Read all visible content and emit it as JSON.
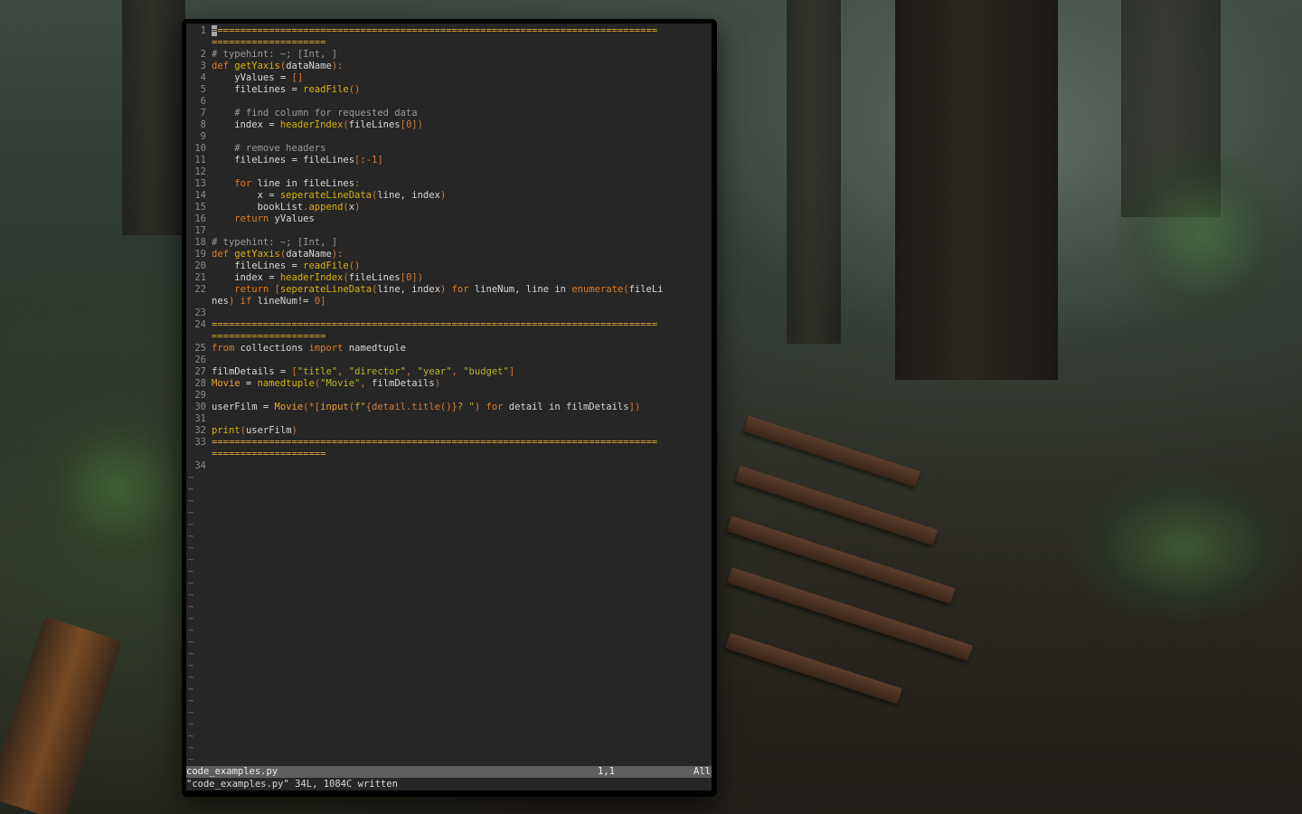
{
  "editor": {
    "lines": [
      {
        "n": "1",
        "segs": [
          {
            "t": "=",
            "c": "cursor"
          },
          {
            "t": "=============================================================================",
            "c": "t-eq"
          }
        ]
      },
      {
        "n": "",
        "segs": [
          {
            "t": "====================",
            "c": "t-eq"
          }
        ]
      },
      {
        "n": "2",
        "segs": [
          {
            "t": "# typehint: ~; [Int, ]",
            "c": "t-c"
          }
        ]
      },
      {
        "n": "3",
        "segs": [
          {
            "t": "def ",
            "c": "t-k"
          },
          {
            "t": "getYaxis",
            "c": "t-f"
          },
          {
            "t": "(",
            "c": "t-p"
          },
          {
            "t": "dataName",
            "c": "t-n"
          },
          {
            "t": "):",
            "c": "t-p"
          }
        ]
      },
      {
        "n": "4",
        "segs": [
          {
            "t": "    yValues = ",
            "c": "t-n"
          },
          {
            "t": "[]",
            "c": "t-p"
          }
        ]
      },
      {
        "n": "5",
        "segs": [
          {
            "t": "    fileLines = ",
            "c": "t-n"
          },
          {
            "t": "readFile",
            "c": "t-f"
          },
          {
            "t": "()",
            "c": "t-p"
          }
        ]
      },
      {
        "n": "6",
        "segs": []
      },
      {
        "n": "7",
        "segs": [
          {
            "t": "    # find column for requested data",
            "c": "t-c"
          }
        ]
      },
      {
        "n": "8",
        "segs": [
          {
            "t": "    index = ",
            "c": "t-n"
          },
          {
            "t": "headerIndex",
            "c": "t-f"
          },
          {
            "t": "(",
            "c": "t-p"
          },
          {
            "t": "fileLines",
            "c": "t-n"
          },
          {
            "t": "[0])",
            "c": "t-p"
          }
        ]
      },
      {
        "n": "9",
        "segs": []
      },
      {
        "n": "10",
        "segs": [
          {
            "t": "    # remove headers",
            "c": "t-c"
          }
        ]
      },
      {
        "n": "11",
        "segs": [
          {
            "t": "    fileLines = fileLines",
            "c": "t-n"
          },
          {
            "t": "[:-1]",
            "c": "t-p"
          }
        ]
      },
      {
        "n": "12",
        "segs": []
      },
      {
        "n": "13",
        "segs": [
          {
            "t": "    for ",
            "c": "t-k"
          },
          {
            "t": "line in fileLines",
            "c": "t-n"
          },
          {
            "t": ":",
            "c": "t-p"
          }
        ]
      },
      {
        "n": "14",
        "segs": [
          {
            "t": "        x = ",
            "c": "t-n"
          },
          {
            "t": "seperateLineData",
            "c": "t-f"
          },
          {
            "t": "(",
            "c": "t-p"
          },
          {
            "t": "line, index",
            "c": "t-n"
          },
          {
            "t": ")",
            "c": "t-p"
          }
        ]
      },
      {
        "n": "15",
        "segs": [
          {
            "t": "        bookList",
            "c": "t-n"
          },
          {
            "t": ".",
            "c": "t-p"
          },
          {
            "t": "append",
            "c": "t-f"
          },
          {
            "t": "(",
            "c": "t-p"
          },
          {
            "t": "x",
            "c": "t-n"
          },
          {
            "t": ")",
            "c": "t-p"
          }
        ]
      },
      {
        "n": "16",
        "segs": [
          {
            "t": "    return ",
            "c": "t-k"
          },
          {
            "t": "yValues",
            "c": "t-n"
          }
        ]
      },
      {
        "n": "17",
        "segs": []
      },
      {
        "n": "18",
        "segs": [
          {
            "t": "# typehint: ~; [Int, ]",
            "c": "t-c"
          }
        ]
      },
      {
        "n": "19",
        "segs": [
          {
            "t": "def ",
            "c": "t-k"
          },
          {
            "t": "getYaxis",
            "c": "t-f"
          },
          {
            "t": "(",
            "c": "t-p"
          },
          {
            "t": "dataName",
            "c": "t-n"
          },
          {
            "t": "):",
            "c": "t-p"
          }
        ]
      },
      {
        "n": "20",
        "segs": [
          {
            "t": "    fileLines = ",
            "c": "t-n"
          },
          {
            "t": "readFile",
            "c": "t-f"
          },
          {
            "t": "()",
            "c": "t-p"
          }
        ]
      },
      {
        "n": "21",
        "segs": [
          {
            "t": "    index = ",
            "c": "t-n"
          },
          {
            "t": "headerIndex",
            "c": "t-f"
          },
          {
            "t": "(",
            "c": "t-p"
          },
          {
            "t": "fileLines",
            "c": "t-n"
          },
          {
            "t": "[0])",
            "c": "t-p"
          }
        ]
      },
      {
        "n": "22",
        "segs": [
          {
            "t": "    return ",
            "c": "t-k"
          },
          {
            "t": "[",
            "c": "t-p"
          },
          {
            "t": "seperateLineData",
            "c": "t-f"
          },
          {
            "t": "(",
            "c": "t-p"
          },
          {
            "t": "line, index",
            "c": "t-n"
          },
          {
            "t": ") ",
            "c": "t-p"
          },
          {
            "t": "for ",
            "c": "t-k"
          },
          {
            "t": "lineNum, line in ",
            "c": "t-n"
          },
          {
            "t": "enumerate",
            "c": "t-k"
          },
          {
            "t": "(",
            "c": "t-p"
          },
          {
            "t": "fileLi",
            "c": "t-n"
          }
        ]
      },
      {
        "n": "",
        "segs": [
          {
            "t": "nes",
            "c": "t-n"
          },
          {
            "t": ") ",
            "c": "t-p"
          },
          {
            "t": "if ",
            "c": "t-k"
          },
          {
            "t": "lineNum!= ",
            "c": "t-n"
          },
          {
            "t": "0]",
            "c": "t-p"
          }
        ]
      },
      {
        "n": "23",
        "segs": []
      },
      {
        "n": "24",
        "segs": [
          {
            "t": "==============================================================================",
            "c": "t-eq"
          }
        ]
      },
      {
        "n": "",
        "segs": [
          {
            "t": "====================",
            "c": "t-eq"
          }
        ]
      },
      {
        "n": "25",
        "segs": [
          {
            "t": "from ",
            "c": "t-k"
          },
          {
            "t": "collections ",
            "c": "t-n"
          },
          {
            "t": "import ",
            "c": "t-k"
          },
          {
            "t": "namedtuple",
            "c": "t-n"
          }
        ]
      },
      {
        "n": "26",
        "segs": []
      },
      {
        "n": "27",
        "segs": [
          {
            "t": "filmDetails = ",
            "c": "t-n"
          },
          {
            "t": "[",
            "c": "t-p"
          },
          {
            "t": "\"title\"",
            "c": "t-s"
          },
          {
            "t": ", ",
            "c": "t-p"
          },
          {
            "t": "\"director\"",
            "c": "t-s"
          },
          {
            "t": ", ",
            "c": "t-p"
          },
          {
            "t": "\"year\"",
            "c": "t-s"
          },
          {
            "t": ", ",
            "c": "t-p"
          },
          {
            "t": "\"budget\"",
            "c": "t-s"
          },
          {
            "t": "]",
            "c": "t-p"
          }
        ]
      },
      {
        "n": "28",
        "segs": [
          {
            "t": "Movie",
            "c": "t-cls"
          },
          {
            "t": " = ",
            "c": "t-n"
          },
          {
            "t": "namedtuple",
            "c": "t-f"
          },
          {
            "t": "(",
            "c": "t-p"
          },
          {
            "t": "\"Movie\"",
            "c": "t-s"
          },
          {
            "t": ", ",
            "c": "t-p"
          },
          {
            "t": "filmDetails",
            "c": "t-n"
          },
          {
            "t": ")",
            "c": "t-p"
          }
        ]
      },
      {
        "n": "29",
        "segs": []
      },
      {
        "n": "30",
        "segs": [
          {
            "t": "userFilm = ",
            "c": "t-n"
          },
          {
            "t": "Movie",
            "c": "t-cls"
          },
          {
            "t": "(*[",
            "c": "t-p"
          },
          {
            "t": "input",
            "c": "t-cls"
          },
          {
            "t": "(",
            "c": "t-p"
          },
          {
            "t": "f\"",
            "c": "t-s"
          },
          {
            "t": "{detail.title()}",
            "c": "t-p"
          },
          {
            "t": "? \"",
            "c": "t-s"
          },
          {
            "t": ") ",
            "c": "t-p"
          },
          {
            "t": "for ",
            "c": "t-k"
          },
          {
            "t": "detail in filmDetails",
            "c": "t-n"
          },
          {
            "t": "])",
            "c": "t-p"
          }
        ]
      },
      {
        "n": "31",
        "segs": []
      },
      {
        "n": "32",
        "segs": [
          {
            "t": "print",
            "c": "t-f"
          },
          {
            "t": "(",
            "c": "t-p"
          },
          {
            "t": "userFilm",
            "c": "t-n"
          },
          {
            "t": ")",
            "c": "t-p"
          }
        ]
      },
      {
        "n": "33",
        "segs": [
          {
            "t": "==============================================================================",
            "c": "t-eq"
          }
        ]
      },
      {
        "n": "",
        "segs": [
          {
            "t": "====================",
            "c": "t-eq"
          }
        ]
      },
      {
        "n": "34",
        "segs": []
      }
    ],
    "tilde_glyph": "~",
    "tilde_count": 25
  },
  "statusbar": {
    "filename": "code_examples.py",
    "position": "1,1",
    "scroll": "All"
  },
  "cmdline": "\"code_examples.py\" 34L, 1084C written"
}
